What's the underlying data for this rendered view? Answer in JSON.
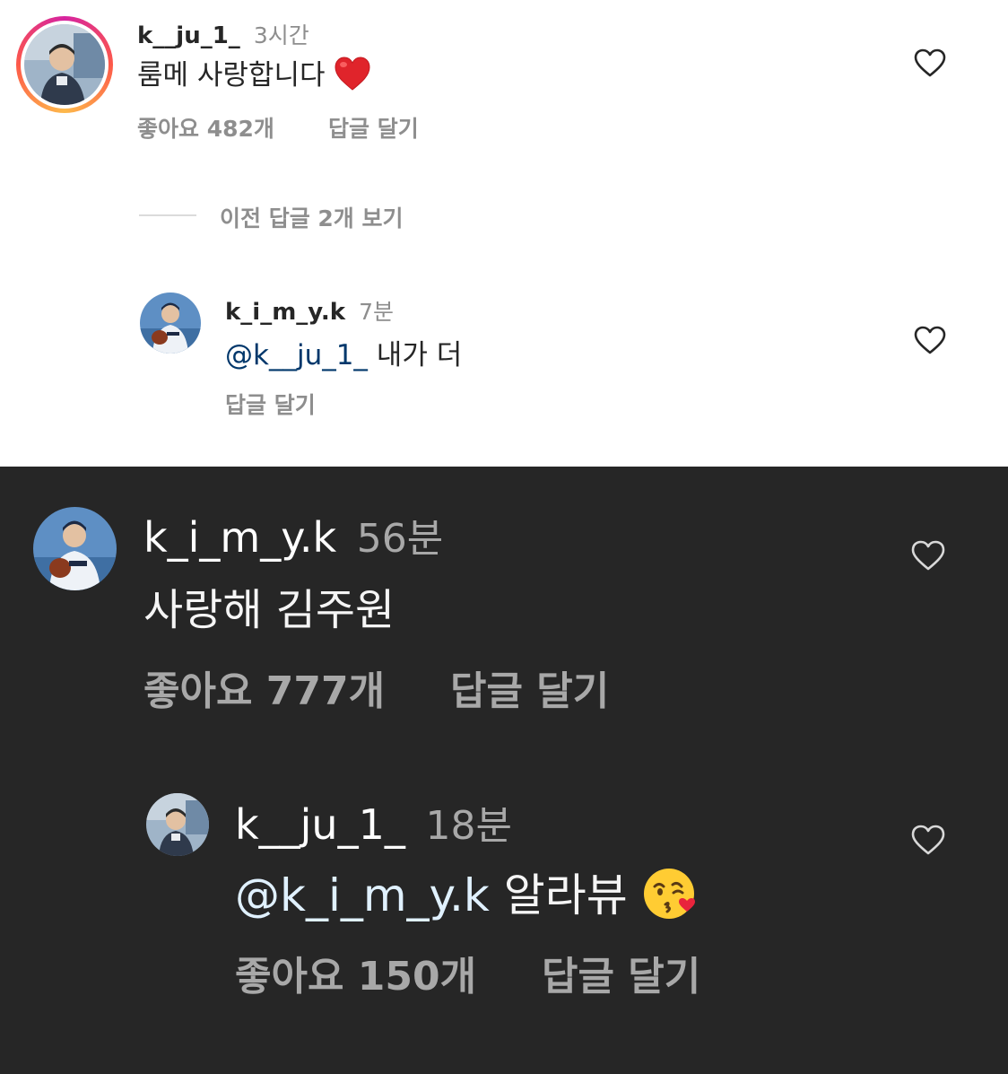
{
  "light_thread": {
    "top_comment": {
      "username": "k__ju_1_",
      "time": "3시간",
      "text": "룸메 사랑합니다",
      "likes": "좋아요 482개",
      "reply_label": "답글 달기"
    },
    "view_previous": "이전 답글 2개 보기",
    "reply": {
      "username": "k_i_m_y.k",
      "time": "7분",
      "mention": "@k__ju_1_",
      "text": "내가 더",
      "reply_label": "답글 달기"
    }
  },
  "dark_thread": {
    "top_comment": {
      "username": "k_i_m_y.k",
      "time": "56분",
      "text": "사랑해 김주원",
      "likes": "좋아요 777개",
      "reply_label": "답글 달기"
    },
    "reply": {
      "username": "k__ju_1_",
      "time": "18분",
      "mention": "@k_i_m_y.k",
      "text": "알라뷰",
      "likes": "좋아요 150개",
      "reply_label": "답글 달기"
    }
  },
  "icons": {
    "heart": "heart-outline-icon",
    "red_heart_emoji": "red-heart-emoji",
    "kiss_emoji": "face-blowing-kiss-emoji"
  },
  "colors": {
    "light_bg": "#ffffff",
    "dark_bg": "#262626",
    "light_mention": "#00376b",
    "dark_mention": "#e0f1ff",
    "secondary_text": "#8e8e8e"
  }
}
